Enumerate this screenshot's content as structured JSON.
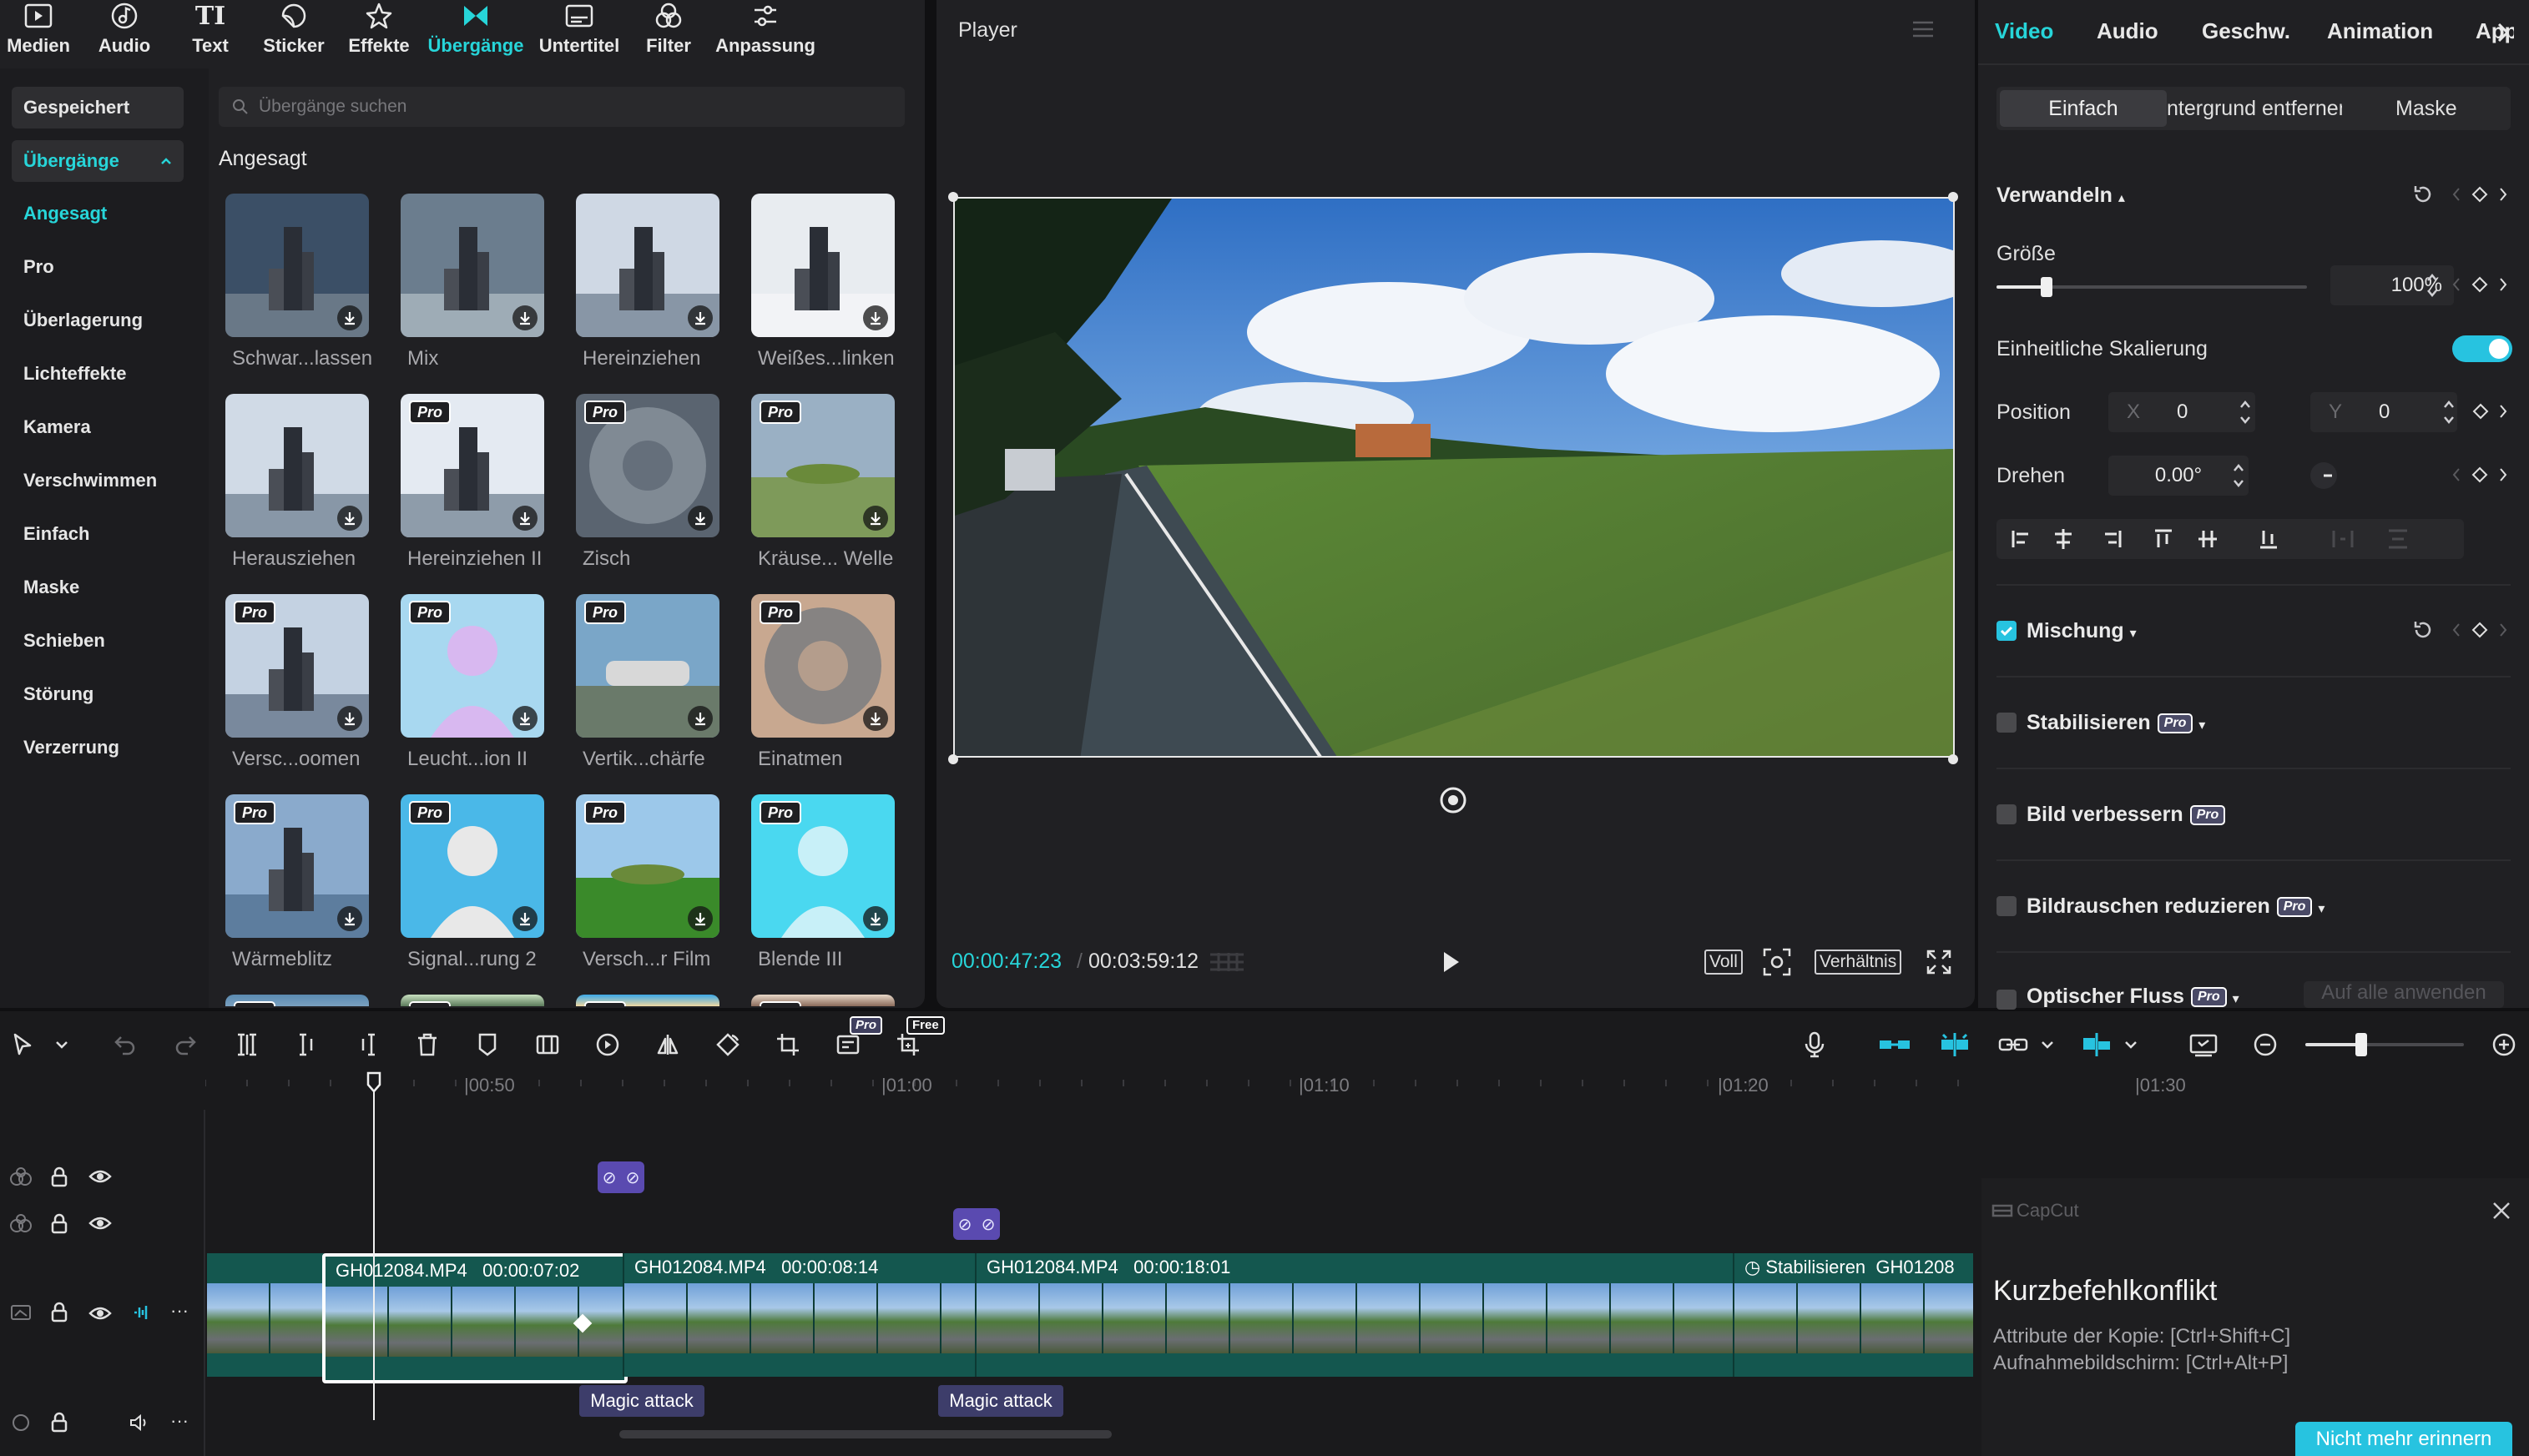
{
  "toolbar": [
    {
      "label": "Medien",
      "icon": "media-icon"
    },
    {
      "label": "Audio",
      "icon": "audio-icon"
    },
    {
      "label": "Text",
      "icon": "text-icon"
    },
    {
      "label": "Sticker",
      "icon": "sticker-icon"
    },
    {
      "label": "Effekte",
      "icon": "effects-icon"
    },
    {
      "label": "Übergänge",
      "icon": "transitions-icon",
      "active": true
    },
    {
      "label": "Untertitel",
      "icon": "subtitles-icon"
    },
    {
      "label": "Filter",
      "icon": "filter-icon"
    },
    {
      "label": "Anpassung",
      "icon": "adjust-icon"
    }
  ],
  "sidebar": {
    "saved": "Gespeichert",
    "expanded": "Übergänge",
    "items": [
      "Angesagt",
      "Pro",
      "Überlagerung",
      "Lichteffekte",
      "Kamera",
      "Verschwimmen",
      "Einfach",
      "Maske",
      "Schieben",
      "Störung",
      "Verzerrung"
    ]
  },
  "search": {
    "placeholder": "Übergänge suchen"
  },
  "section_title": "Angesagt",
  "tiles": [
    {
      "label": "Schwar...lassen",
      "pro": false
    },
    {
      "label": "Mix",
      "pro": false
    },
    {
      "label": "Hereinziehen",
      "pro": false
    },
    {
      "label": "Weißes...linken",
      "pro": false
    },
    {
      "label": "Herausziehen",
      "pro": false
    },
    {
      "label": "Hereinziehen II",
      "pro": true
    },
    {
      "label": "Zisch",
      "pro": true
    },
    {
      "label": "Kräuse... Welle",
      "pro": true
    },
    {
      "label": "Versc...oomen",
      "pro": true
    },
    {
      "label": "Leucht...ion II",
      "pro": true
    },
    {
      "label": "Vertik...chärfe",
      "pro": true
    },
    {
      "label": "Einatmen",
      "pro": true
    },
    {
      "label": "Wärmeblitz",
      "pro": true
    },
    {
      "label": "Signal...rung 2",
      "pro": true
    },
    {
      "label": "Versch...r Film",
      "pro": true
    },
    {
      "label": "Blende III",
      "pro": true
    }
  ],
  "pro_badge": "Pro",
  "free_badge": "Free",
  "player": {
    "title": "Player",
    "current_time": "00:00:47:23",
    "total_time": "00:03:59:12",
    "full_label": "Voll",
    "ratio_label": "Verhältnis"
  },
  "inspector": {
    "tabs": [
      "Video",
      "Audio",
      "Geschw.",
      "Animation",
      "App"
    ],
    "subtabs": [
      "Einfach",
      "ntergrund entfernen",
      "Maske"
    ],
    "transform_title": "Verwandeln",
    "size_label": "Größe",
    "size_value": "100%",
    "size_fraction": 0.16,
    "uniform_label": "Einheitliche Skalierung",
    "position_label": "Position",
    "pos_x_label": "X",
    "pos_x": "0",
    "pos_y_label": "Y",
    "pos_y": "0",
    "rotate_label": "Drehen",
    "rotate_value": "0.00°",
    "blend_title": "Mischung",
    "stabilize_title": "Stabilisieren",
    "enhance_title": "Bild verbessern",
    "denoise_title": "Bildrauschen reduzieren",
    "flow_title": "Optischer Fluss",
    "apply_all": "Auf alle anwenden",
    "accent": "#27d5d9"
  },
  "timeline": {
    "ruler": [
      "00:50",
      "01:00",
      "01:10",
      "01:20",
      "01:30"
    ],
    "clips": [
      {
        "name": "GH012084.MP4",
        "duration": "00:00:07:02"
      },
      {
        "name": "GH012084.MP4",
        "duration": "00:00:08:14"
      },
      {
        "name": "GH012084.MP4",
        "duration": "00:00:18:01"
      },
      {
        "name": "GH01208",
        "prefix": "Stabilisieren"
      }
    ],
    "effects": [
      "Magic attack",
      "Magic attack"
    ],
    "zoom_fraction": 0.35
  },
  "toast": {
    "brand": "CapCut",
    "title": "Kurzbefehlkonflikt",
    "line1": "Attribute der Kopie: [Ctrl+Shift+C]",
    "line2": "Aufnahmebildschirm: [Ctrl+Alt+P]",
    "button": "Nicht mehr erinnern"
  }
}
